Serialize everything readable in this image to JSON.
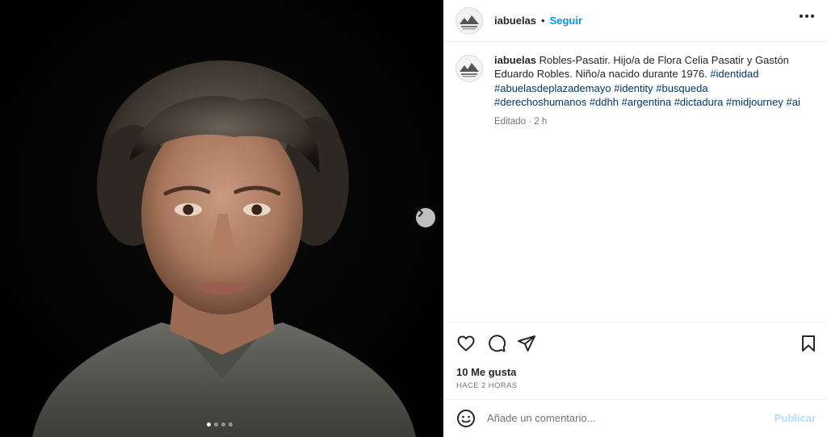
{
  "post": {
    "username": "iabuelas",
    "separator": "•",
    "follow_label": "Seguir",
    "more_icon": "more-horizontal-icon"
  },
  "media": {
    "alt": "Retrato de una mujer de mediana edad con cabello ondulado canoso y camisa gris",
    "carousel_total": 4,
    "carousel_active": 1,
    "next_icon": "chevron-right-icon"
  },
  "caption": {
    "username": "iabuelas",
    "text": "Robles-Pasatir. Hijo/a de Flora Celia Pasatir y Gastón Eduardo Robles. Niño/a nacido durante 1976.",
    "hashtags": [
      "#identidad",
      "#abuelasdeplazademayo",
      "#identity",
      "#busqueda",
      "#derechoshumanos",
      "#ddhh",
      "#argentina",
      "#dictadura",
      "#midjourney",
      "#ai"
    ],
    "meta": "Editado · 2 h"
  },
  "actions": {
    "like_icon": "heart-icon",
    "comment_icon": "comment-icon",
    "share_icon": "send-icon",
    "save_icon": "bookmark-icon",
    "likes_text": "10 Me gusta",
    "time_text": "HACE 2 HORAS"
  },
  "comment": {
    "emoji_icon": "emoji-icon",
    "placeholder": "Añade un comentario...",
    "publish_label": "Publicar"
  },
  "colors": {
    "accent": "#0095f6",
    "hashtag": "#00376b",
    "publish_disabled": "#b3dbff"
  }
}
